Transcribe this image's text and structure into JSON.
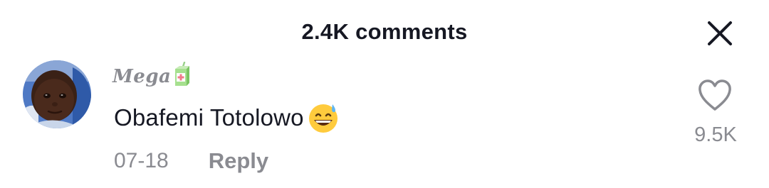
{
  "header": {
    "title": "2.4K comments",
    "close_icon": "close-icon"
  },
  "comment": {
    "avatar_icon": "user-avatar",
    "username": "Mega",
    "username_emoji": "beverage-box-emoji",
    "text": "Obafemi Totolowo",
    "text_emoji": "grinning-face-with-sweat-emoji",
    "date": "07-18",
    "reply_label": "Reply",
    "like_icon": "heart-outline-icon",
    "like_count": "9.5K"
  },
  "colors": {
    "primary_text": "#161823",
    "secondary_text": "#8a8b91",
    "background": "#ffffff"
  }
}
